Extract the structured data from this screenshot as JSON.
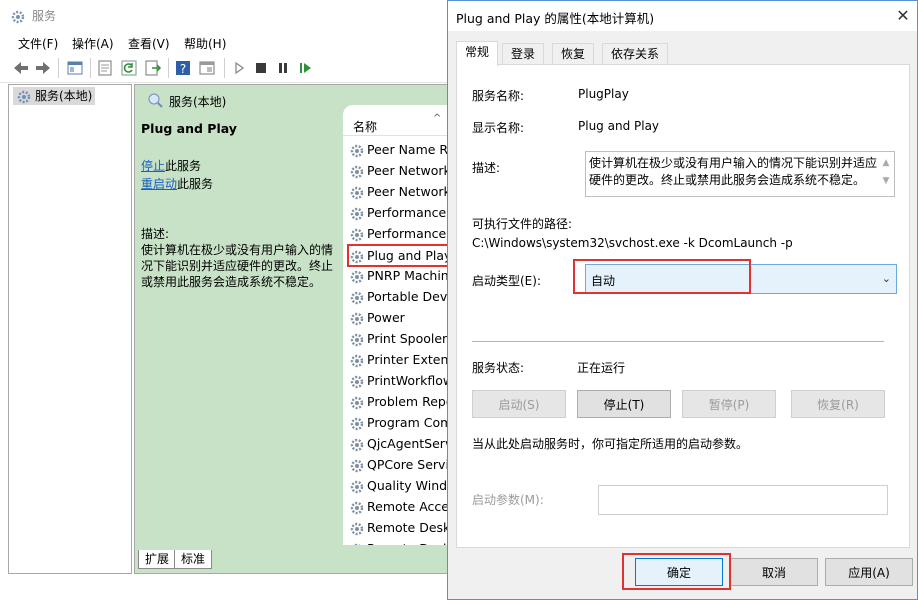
{
  "main_window": {
    "title": "服务",
    "menu": [
      "文件(F)",
      "操作(A)",
      "查看(V)",
      "帮助(H)"
    ],
    "tree_item": "服务(本地)",
    "content_header": "服务(本地)",
    "detail": {
      "service_name": "Plug and Play",
      "stop_link": "停止",
      "stop_suffix": "此服务",
      "restart_link": "重启动",
      "restart_suffix": "此服务",
      "description_label": "描述:",
      "description": "使计算机在极少或没有用户输入的情况下能识别并适应硬件的更改。终止或禁用此服务会造成系统不稳定。"
    },
    "list_header": "名称",
    "services": [
      "Peer Name R",
      "Peer Network",
      "Peer Network",
      "Performance",
      "Performance",
      "Plug and Play",
      "PNRP Machin",
      "Portable Devi",
      "Power",
      "Print Spooler",
      "Printer Extens",
      "PrintWorkflow",
      "Problem Repo",
      "Program Com",
      "QjcAgentServ",
      "QPCore Servi",
      "Quality Windo",
      "Remote Acces",
      "Remote Deskt",
      "Remote Deskt"
    ],
    "selected_index": 5,
    "view_tabs": [
      "扩展",
      "标准"
    ]
  },
  "dialog": {
    "title": "Plug and Play 的属性(本地计算机)",
    "tabs": [
      "常规",
      "登录",
      "恢复",
      "依存关系"
    ],
    "service_name_label": "服务名称:",
    "service_name_value": "PlugPlay",
    "display_name_label": "显示名称:",
    "display_name_value": "Plug and Play",
    "description_label": "描述:",
    "description_value": "使计算机在极少或没有用户输入的情况下能识别并适应硬件的更改。终止或禁用此服务会造成系统不稳定。",
    "exe_path_label": "可执行文件的路径:",
    "exe_path_value": "C:\\Windows\\system32\\svchost.exe -k DcomLaunch -p",
    "startup_type_label": "启动类型(E):",
    "startup_type_value": "自动",
    "status_label": "服务状态:",
    "status_value": "正在运行",
    "buttons": {
      "start": "启动(S)",
      "stop": "停止(T)",
      "pause": "暂停(P)",
      "resume": "恢复(R)"
    },
    "hint": "当从此处启动服务时，你可指定所适用的启动参数。",
    "param_label": "启动参数(M):",
    "param_value": "",
    "ok": "确定",
    "cancel": "取消",
    "apply": "应用(A)"
  },
  "colors": {
    "highlight": "#e03232",
    "content_bg": "#c7e2c6",
    "link": "#1a5fc0",
    "ok_border": "#0078d7"
  }
}
